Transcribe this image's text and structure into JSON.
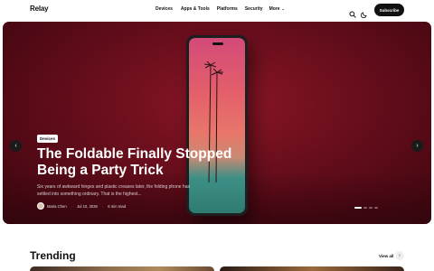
{
  "header": {
    "logo": "Relay",
    "nav": [
      "Devices",
      "Apps & Tools",
      "Platforms",
      "Security",
      "More"
    ],
    "subscribe_label": "Subscribe"
  },
  "hero": {
    "tag": "Devices",
    "title": "The Foldable Finally Stopped Being a Party Trick",
    "excerpt": "Six years of awkward hinges and plastic creases later, the folding phone has settled into something ordinary. That is the highest...",
    "author": "Maria Chen",
    "date": "Jul 10, 2026",
    "read_time": "6 min read",
    "slide_count": 4,
    "active_slide": 1
  },
  "trending": {
    "heading": "Trending",
    "view_all_label": "View all"
  },
  "colors": {
    "hero_bg": "#6e0f1e",
    "button_dark": "#111111"
  }
}
